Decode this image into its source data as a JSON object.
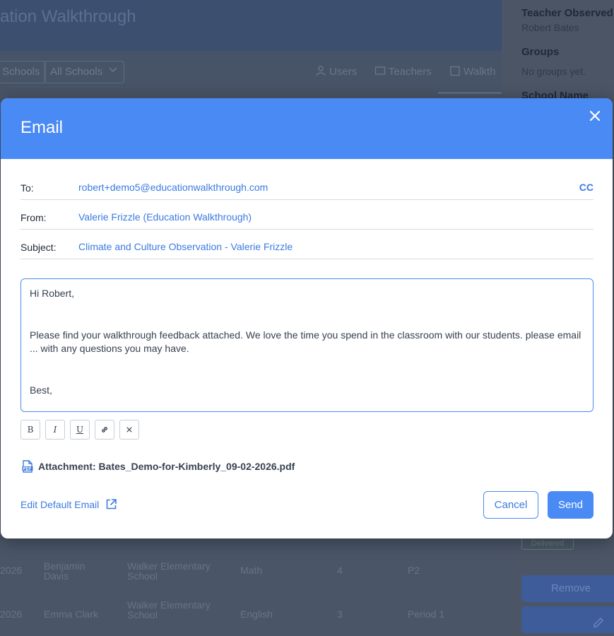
{
  "background": {
    "title": "ation Walkthrough",
    "filters": {
      "school_left": "Schools",
      "school_all": "All Schools"
    },
    "tabs": [
      "Users",
      "Teachers",
      "Walkth"
    ],
    "rows": [
      {
        "date": "2026",
        "teacher": "Benjamin Davis",
        "school": "Walker Elementary School",
        "subject": "Math",
        "grade": "4",
        "period": "P2"
      },
      {
        "date": "2026",
        "teacher": "Emma Clark",
        "school": "Walker Elementary School",
        "subject": "English",
        "grade": "3",
        "period": "Period 1"
      }
    ],
    "panel": {
      "teacher_label": "Teacher Observed",
      "teacher_value": "Robert Bates",
      "groups_label": "Groups",
      "groups_value": "No groups yet.",
      "school_label": "School Name",
      "status_badge": "Delivered",
      "remove_label": "Remove"
    }
  },
  "modal": {
    "title": "Email",
    "to_label": "To:",
    "to_value": "robert+demo5@educationwalkthrough.com",
    "cc_label": "CC",
    "from_label": "From:",
    "from_value": "Valerie Frizzle (Education Walkthrough)",
    "subject_label": "Subject:",
    "subject_value": "Climate and Culture Observation - Valerie Frizzle",
    "body": {
      "greeting": "Hi Robert,",
      "paragraph": "Please find your walkthrough feedback attached. We love the time you spend in the classroom with our students. please email ... with any questions you may have.",
      "signoff": "Best,"
    },
    "toolbar": {
      "bold": "B",
      "italic": "I",
      "underline": "U"
    },
    "attachment": "Attachment: Bates_Demo-for-Kimberly_09-02-2026.pdf",
    "edit_default": "Edit Default Email",
    "cancel_label": "Cancel",
    "send_label": "Send"
  },
  "colors": {
    "accent": "#4a8af4",
    "link": "#3b7be0",
    "overlay": "#4a5568"
  }
}
